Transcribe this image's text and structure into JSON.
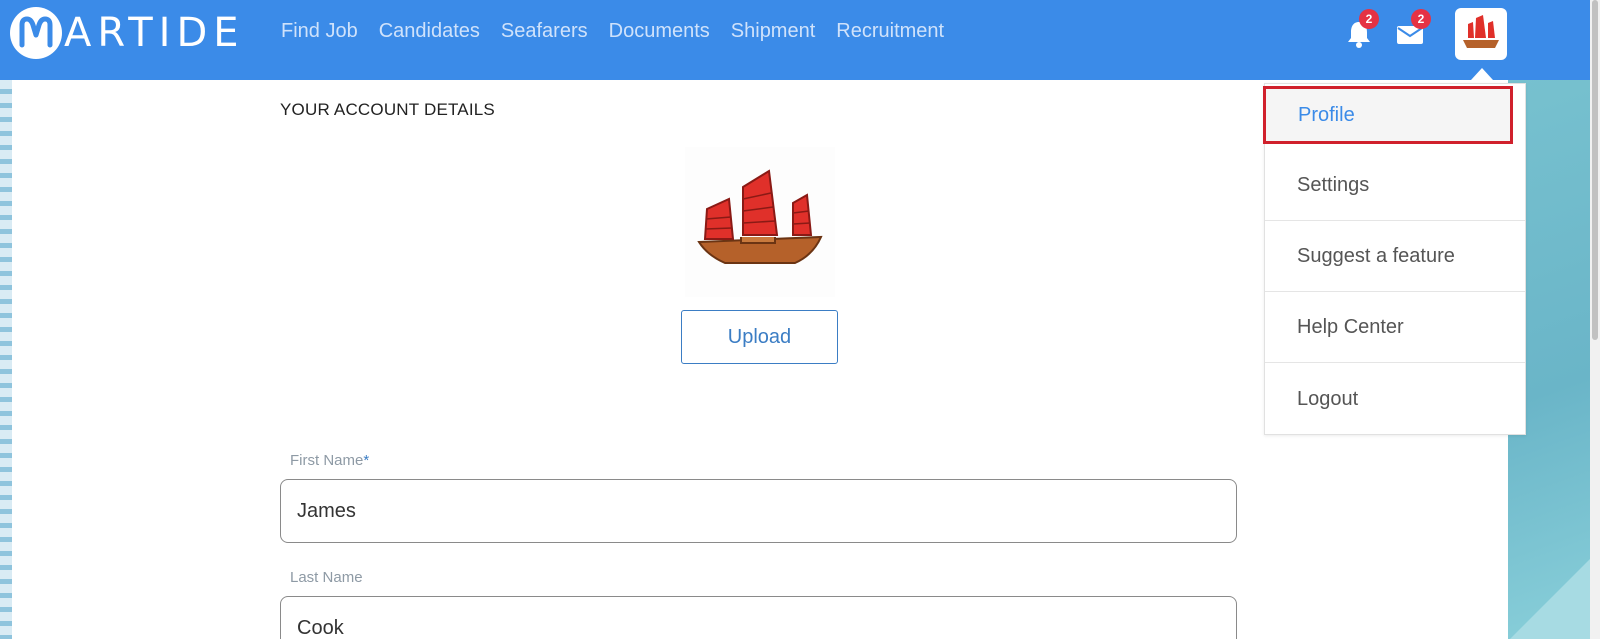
{
  "header": {
    "logo_text": "ARTIDE",
    "logo_letter": "M",
    "nav": [
      "Find Job",
      "Candidates",
      "Seafarers",
      "Documents",
      "Shipment",
      "Recruitment"
    ],
    "notifications_count": "2",
    "messages_count": "2"
  },
  "dropdown": {
    "items": [
      "Profile",
      "Settings",
      "Suggest a feature",
      "Help Center",
      "Logout"
    ]
  },
  "main": {
    "section_title": "YOUR ACCOUNT DETAILS",
    "upload_label": "Upload",
    "first_name": {
      "label": "First Name",
      "required_mark": "*",
      "value": "James"
    },
    "last_name": {
      "label": "Last Name",
      "value": "Cook"
    }
  },
  "colors": {
    "header_bg": "#3b8be8",
    "badge": "#e53244",
    "accent": "#3b7dc4",
    "highlight_border": "#d0202c"
  }
}
